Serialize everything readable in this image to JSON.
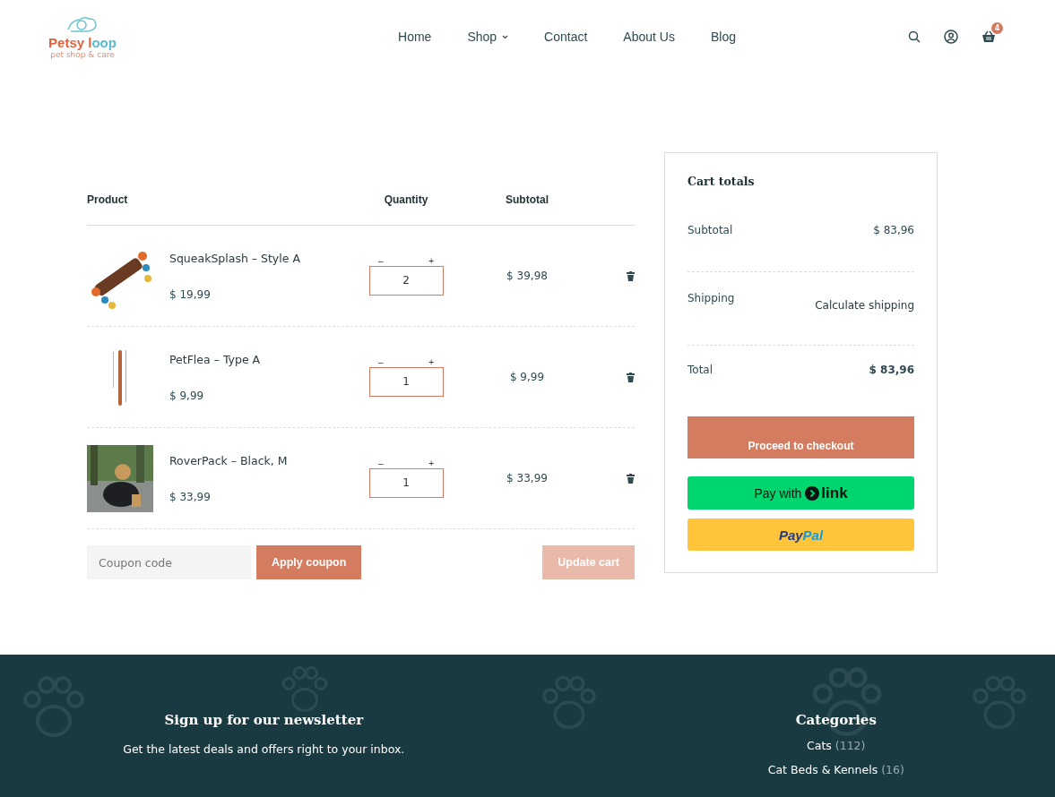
{
  "header": {
    "logo": {
      "name": "Petsy l",
      "name_accent": "oop",
      "tagline": "pet shop & care"
    },
    "nav": [
      {
        "label": "Home",
        "has_menu": false
      },
      {
        "label": "Shop",
        "has_menu": true
      },
      {
        "label": "Contact",
        "has_menu": false
      },
      {
        "label": "About Us",
        "has_menu": false
      },
      {
        "label": "Blog",
        "has_menu": false
      }
    ],
    "cart_count": "4"
  },
  "cart": {
    "columns": [
      "Product",
      "Quantity",
      "Subtotal"
    ],
    "rows": [
      {
        "name": "SqueakSplash – Style A",
        "price": "$ 19,99",
        "quantity": "2",
        "subtotal": "$ 39,98",
        "minus": "–",
        "plus": "+"
      },
      {
        "name": "PetFlea – Type A",
        "price": "$ 9,99",
        "quantity": "1",
        "subtotal": "$ 9,99",
        "minus": "–",
        "plus": "+"
      },
      {
        "name": "RoverPack – Black, M",
        "price": "$ 33,99",
        "quantity": "1",
        "subtotal": "$ 33,99",
        "minus": "–",
        "plus": "+"
      }
    ],
    "coupon": {
      "placeholder": "Coupon code",
      "apply": "Apply coupon"
    },
    "update": {
      "label": "Update cart",
      "disabled": true
    }
  },
  "totals": {
    "title": "Cart totals",
    "subtotal_label": "Subtotal",
    "subtotal": "$ 83,96",
    "shipping_label": "Shipping",
    "shipping_link": "Calculate shipping",
    "total_label": "Total",
    "total": "$ 83,96",
    "checkout": "Proceed to checkout",
    "link_pay": "Pay with",
    "link_logo": "link",
    "paypal_1": "Pay",
    "paypal_2": "Pal"
  },
  "footer": {
    "newsletter_title": "Sign up for our newsletter",
    "newsletter_text": "Get the latest deals and offers right to your inbox.",
    "categories_title": "Categories",
    "categories": [
      {
        "name": "Cats",
        "count": "(112)"
      },
      {
        "name": "Cat Beds & Kennels",
        "count": "(16)"
      }
    ]
  }
}
